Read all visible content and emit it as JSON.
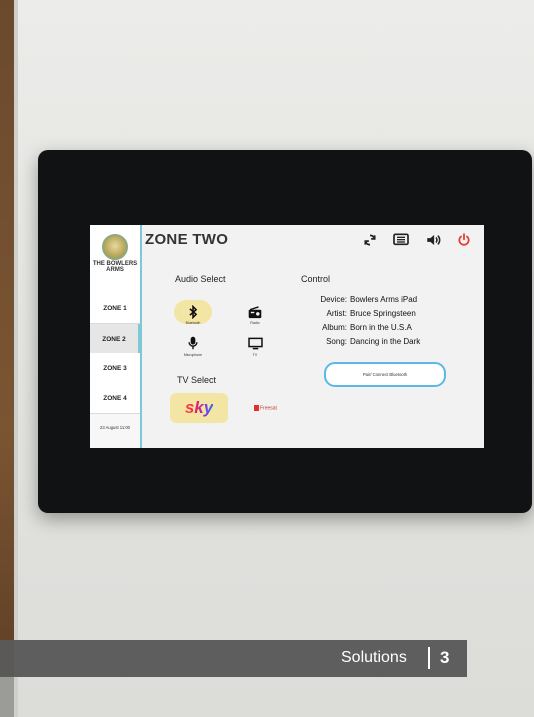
{
  "sidebar": {
    "logo_text": "THE BOWLERS ARMS",
    "zones": [
      "ZONE 1",
      "ZONE 2",
      "ZONE 3",
      "ZONE 4"
    ],
    "date": "23 August 11:00"
  },
  "header": {
    "title": "ZONE TWO",
    "icons": [
      "refresh-icon",
      "menu-icon",
      "volume-icon",
      "power-icon"
    ],
    "power_color": "#e53935"
  },
  "audio_select": {
    "title": "Audio Select",
    "options": [
      {
        "icon": "bluetooth-icon",
        "label": "Bluetooth",
        "selected": true
      },
      {
        "icon": "radio-icon",
        "label": "Radio",
        "selected": false
      },
      {
        "icon": "microphone-icon",
        "label": "Microphone",
        "selected": false
      },
      {
        "icon": "tv-icon",
        "label": "TV",
        "selected": false
      }
    ]
  },
  "tv_select": {
    "title": "TV Select",
    "sky_label": "sky",
    "freesat_label": "Freesat"
  },
  "control": {
    "title": "Control",
    "rows": [
      {
        "key": "Device:",
        "value": "Bowlers Arms iPad"
      },
      {
        "key": "Artist:",
        "value": "Bruce Springsteen"
      },
      {
        "key": "Album:",
        "value": "Born in the U.S.A"
      },
      {
        "key": "Song:",
        "value": "Dancing in the Dark"
      }
    ],
    "pair_button": "Pair/ Connect Bluetooth"
  },
  "banner": {
    "text": "Solutions",
    "number": "3"
  },
  "colors": {
    "accent": "#7fc9d6",
    "selected": "#f3e6a5",
    "banner": "#5a5a5a"
  }
}
